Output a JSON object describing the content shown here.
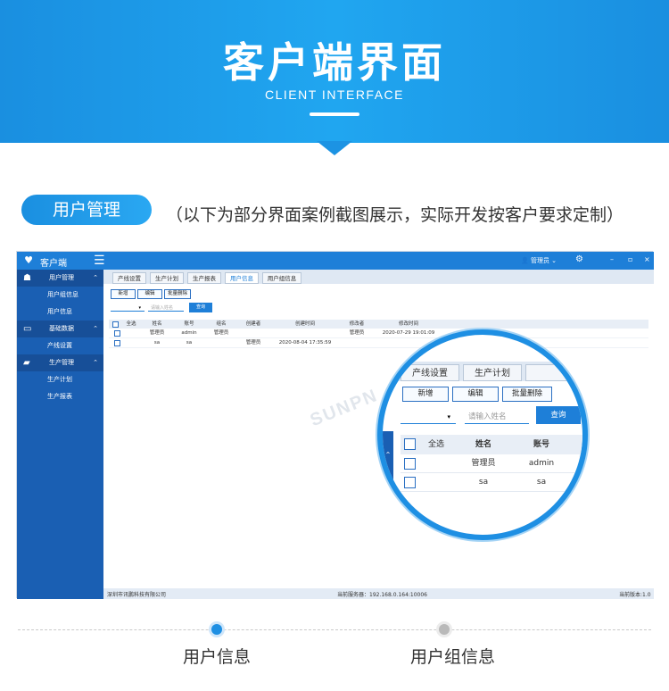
{
  "banner": {
    "title": "客户端界面",
    "subtitle": "CLIENT INTERFACE"
  },
  "section": {
    "tag": "用户管理",
    "note": "（以下为部分界面案例截图展示，实际开发按客户要求定制）"
  },
  "app": {
    "title": "客户端",
    "user_label": "管理员",
    "sidebar": {
      "groups": [
        {
          "label": "用户管理",
          "items": [
            "用户组信息",
            "用户信息"
          ]
        },
        {
          "label": "基础数据",
          "items": [
            "产线设置"
          ]
        },
        {
          "label": "生产管理",
          "items": [
            "生产计划",
            "生产报表"
          ]
        }
      ]
    },
    "tabs": [
      "产线设置",
      "生产计划",
      "生产报表",
      "用户信息",
      "用户组信息"
    ],
    "buttons": [
      "新增",
      "编辑",
      "批量删除"
    ],
    "search_placeholder": "请输入姓名",
    "query_label": "查询",
    "table": {
      "headers": [
        "全选",
        "姓名",
        "账号",
        "组名",
        "创建者",
        "创建时间",
        "修改者",
        "修改时间"
      ],
      "rows": [
        [
          "管理员",
          "admin",
          "管理员",
          "",
          "",
          "管理员",
          "2020-07-29 19:01:09"
        ],
        [
          "sa",
          "sa",
          "",
          "管理员",
          "2020-08-04 17:35:59",
          "",
          ""
        ]
      ]
    },
    "status": {
      "company": "深圳市讯鹏科技有限公司",
      "server": "当前服务器：192.168.0.164:10006",
      "version": "当前版本:1.0"
    }
  },
  "magnifier": {
    "tabs": [
      "产线设置",
      "生产计划"
    ],
    "buttons": [
      "新增",
      "编辑",
      "批量删除"
    ],
    "search_placeholder": "请输入姓名",
    "query_label": "查询",
    "headers": [
      "全选",
      "姓名",
      "账号"
    ],
    "rows": [
      [
        "管理员",
        "admin"
      ],
      [
        "sa",
        "sa"
      ]
    ]
  },
  "watermark": "SUNPN",
  "bottom_nav": [
    "用户信息",
    "用户组信息"
  ]
}
